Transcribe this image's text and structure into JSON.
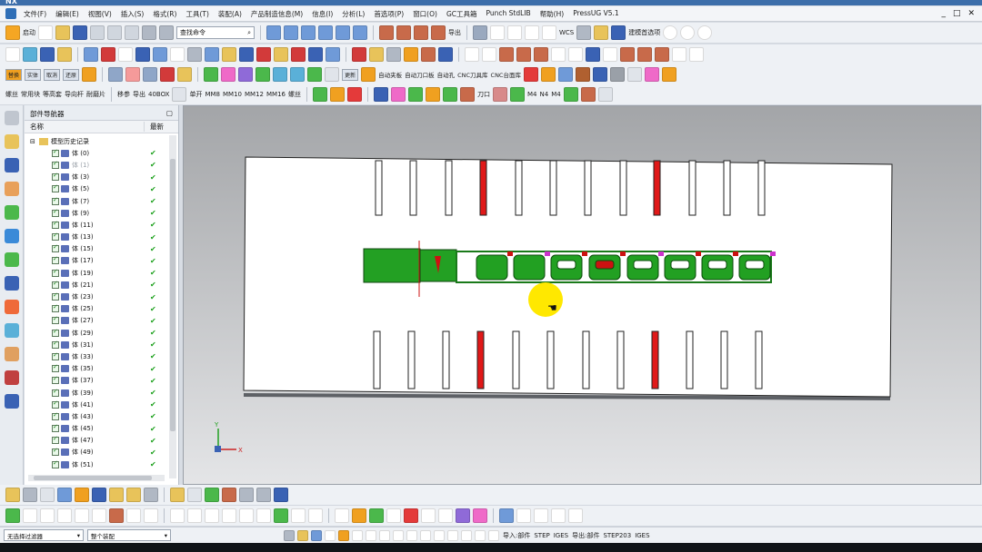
{
  "app": {
    "logo": "NX"
  },
  "menu": {
    "items": [
      "文件(F)",
      "编辑(E)",
      "视图(V)",
      "插入(S)",
      "格式(R)",
      "工具(T)",
      "装配(A)",
      "产品制造信息(M)",
      "信息(I)",
      "分析(L)",
      "首选项(P)",
      "窗口(O)",
      "GC工具箱",
      "Punch StdLIB",
      "帮助(H)",
      "PressUG V5.1"
    ],
    "window_controls": [
      "_",
      "□",
      "✕"
    ]
  },
  "toolbar1": {
    "start_label": "启动",
    "search_placeholder": "查找命令",
    "export_label": "导出",
    "wcs_label": "WCS",
    "modeling_prefs_label": "建模首选项"
  },
  "toolbar3": {
    "labels": [
      "替换",
      "实体",
      "取消",
      "还原",
      "更新",
      "自动夹板",
      "自动刀口板",
      "自动孔",
      "CNC刀具库",
      "CNC台面库"
    ]
  },
  "toolbar4": {
    "labels": [
      "螺丝",
      "常用块",
      "等高套",
      "导向杆",
      "耐磨片",
      "移参",
      "导出",
      "40BOX",
      "单开",
      "MM8",
      "MM10",
      "MM12",
      "MM16",
      "螺丝",
      "刀口",
      "M4",
      "N4",
      "M4"
    ]
  },
  "navigator": {
    "title": "部件导航器",
    "col_name": "名称",
    "col_latest": "最新",
    "root_label": "模型历史记录",
    "items": [
      {
        "label": "体 (0)",
        "dim": false
      },
      {
        "label": "体 (1)",
        "dim": true
      },
      {
        "label": "体 (3)",
        "dim": false
      },
      {
        "label": "体 (5)",
        "dim": false
      },
      {
        "label": "体 (7)",
        "dim": false
      },
      {
        "label": "体 (9)",
        "dim": false
      },
      {
        "label": "体 (11)",
        "dim": false
      },
      {
        "label": "体 (13)",
        "dim": false
      },
      {
        "label": "体 (15)",
        "dim": false
      },
      {
        "label": "体 (17)",
        "dim": false
      },
      {
        "label": "体 (19)",
        "dim": false
      },
      {
        "label": "体 (21)",
        "dim": false
      },
      {
        "label": "体 (23)",
        "dim": false
      },
      {
        "label": "体 (25)",
        "dim": false
      },
      {
        "label": "体 (27)",
        "dim": false
      },
      {
        "label": "体 (29)",
        "dim": false
      },
      {
        "label": "体 (31)",
        "dim": false
      },
      {
        "label": "体 (33)",
        "dim": false
      },
      {
        "label": "体 (35)",
        "dim": false
      },
      {
        "label": "体 (37)",
        "dim": false
      },
      {
        "label": "体 (39)",
        "dim": false
      },
      {
        "label": "体 (41)",
        "dim": false
      },
      {
        "label": "体 (43)",
        "dim": false
      },
      {
        "label": "体 (45)",
        "dim": false
      },
      {
        "label": "体 (47)",
        "dim": false
      },
      {
        "label": "体 (49)",
        "dim": false
      },
      {
        "label": "体 (51)",
        "dim": false
      }
    ],
    "ok_mark": "✔"
  },
  "viewport": {
    "axis_x": "X",
    "axis_y": "Y"
  },
  "statusbar": {
    "filter_value": "无选择过滤器",
    "assembly_value": "整个装配",
    "import_label": "导入:部件",
    "step_label": "STEP",
    "iges_label": "IGES",
    "export_label": "导出:部件",
    "step203_label": "STEP203",
    "iges2_label": "IGES"
  },
  "colors": {
    "accent": "#3c6eaa",
    "strip_green": "#22a022",
    "slot_red": "#e01818",
    "cursor_yellow": "#ffe800"
  }
}
